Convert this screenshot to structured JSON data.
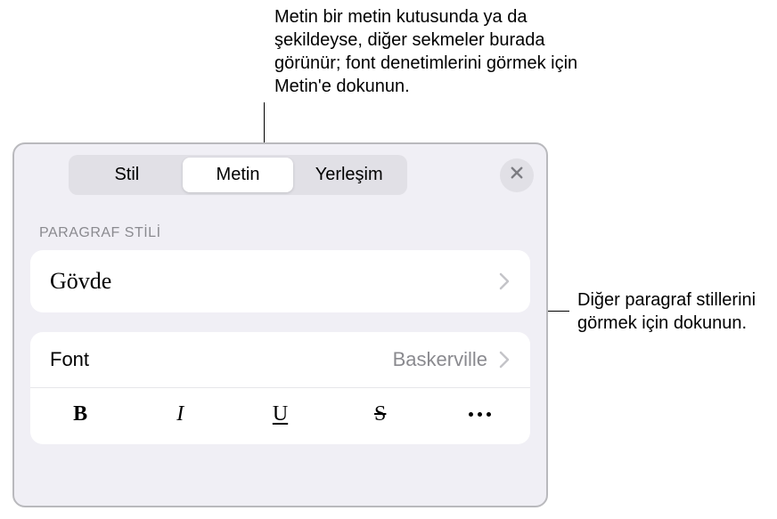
{
  "callouts": {
    "top": "Metin bir metin kutusunda ya da şekildeyse, diğer sekmeler burada görünür; font denetimlerini görmek için Metin'e dokunun.",
    "right": "Diğer paragraf stillerini görmek için dokunun."
  },
  "tabs": {
    "items": [
      {
        "label": "Stil"
      },
      {
        "label": "Metin"
      },
      {
        "label": "Yerleşim"
      }
    ],
    "activeIndex": 1
  },
  "paragraphStyle": {
    "header": "PARAGRAF STİLİ",
    "current": "Gövde"
  },
  "font": {
    "label": "Font",
    "value": "Baskerville",
    "styleButtons": {
      "bold": "B",
      "italic": "I",
      "underline": "U",
      "strike": "S"
    }
  }
}
